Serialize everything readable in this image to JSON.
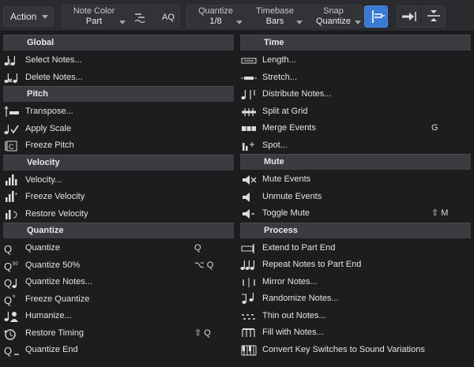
{
  "toolbar": {
    "action_label": "Action",
    "note_color_label": "Note Color",
    "note_color_value": "Part",
    "aq_label": "AQ",
    "quantize_label": "Quantize",
    "quantize_value": "1/8",
    "timebase_label": "Timebase",
    "timebase_value": "Bars",
    "snap_label": "Snap",
    "snap_value": "Quantize"
  },
  "left_sections": [
    {
      "header": "Global",
      "items": [
        {
          "label": "Select Notes...",
          "shortcut": ""
        },
        {
          "label": "Delete Notes...",
          "shortcut": ""
        }
      ]
    },
    {
      "header": "Pitch",
      "items": [
        {
          "label": "Transpose...",
          "shortcut": ""
        },
        {
          "label": "Apply Scale",
          "shortcut": ""
        },
        {
          "label": "Freeze Pitch",
          "shortcut": ""
        }
      ]
    },
    {
      "header": "Velocity",
      "items": [
        {
          "label": "Velocity...",
          "shortcut": ""
        },
        {
          "label": "Freeze Velocity",
          "shortcut": ""
        },
        {
          "label": "Restore Velocity",
          "shortcut": ""
        }
      ]
    },
    {
      "header": "Quantize",
      "items": [
        {
          "label": "Quantize",
          "shortcut": "Q"
        },
        {
          "label": "Quantize 50%",
          "shortcut": "⌥ Q"
        },
        {
          "label": "Quantize Notes...",
          "shortcut": ""
        },
        {
          "label": "Freeze Quantize",
          "shortcut": ""
        },
        {
          "label": "Humanize...",
          "shortcut": ""
        },
        {
          "label": "Restore Timing",
          "shortcut": "⇧ Q"
        },
        {
          "label": "Quantize End",
          "shortcut": ""
        }
      ]
    }
  ],
  "right_sections": [
    {
      "header": "Time",
      "items": [
        {
          "label": "Length...",
          "shortcut": ""
        },
        {
          "label": "Stretch...",
          "shortcut": ""
        },
        {
          "label": "Distribute Notes...",
          "shortcut": ""
        },
        {
          "label": "Split at Grid",
          "shortcut": ""
        },
        {
          "label": "Merge Events",
          "shortcut": "G"
        },
        {
          "label": "Spot...",
          "shortcut": ""
        }
      ]
    },
    {
      "header": "Mute",
      "items": [
        {
          "label": "Mute Events",
          "shortcut": ""
        },
        {
          "label": "Unmute Events",
          "shortcut": ""
        },
        {
          "label": "Toggle Mute",
          "shortcut": "⇧ M"
        }
      ]
    },
    {
      "header": "Process",
      "items": [
        {
          "label": "Extend to Part End",
          "shortcut": ""
        },
        {
          "label": "Repeat Notes to Part End",
          "shortcut": ""
        },
        {
          "label": "Mirror Notes...",
          "shortcut": ""
        },
        {
          "label": "Randomize Notes...",
          "shortcut": ""
        },
        {
          "label": "Thin out Notes...",
          "shortcut": ""
        },
        {
          "label": "Fill with Notes...",
          "shortcut": ""
        },
        {
          "label": "Convert Key Switches to Sound Variations",
          "shortcut": ""
        }
      ]
    }
  ],
  "icons": {
    "left": [
      "select-notes-icon",
      "delete-notes-icon",
      "transpose-icon",
      "apply-scale-icon",
      "freeze-pitch-icon",
      "velocity-icon",
      "freeze-velocity-icon",
      "restore-velocity-icon",
      "quantize-icon",
      "quantize-50-icon",
      "quantize-notes-icon",
      "freeze-quantize-icon",
      "humanize-icon",
      "restore-timing-icon",
      "quantize-end-icon"
    ],
    "right": [
      "length-icon",
      "stretch-icon",
      "distribute-notes-icon",
      "split-at-grid-icon",
      "merge-events-icon",
      "spot-icon",
      "mute-events-icon",
      "unmute-events-icon",
      "toggle-mute-icon",
      "extend-to-part-end-icon",
      "repeat-notes-icon",
      "mirror-notes-icon",
      "randomize-notes-icon",
      "thin-out-notes-icon",
      "fill-with-notes-icon",
      "convert-key-switches-icon"
    ]
  },
  "colors": {
    "background": "#1c1d1f",
    "section_header": "#3b3c40",
    "toolbar": "#2a2b2e",
    "accent": "#3a7ad6"
  }
}
